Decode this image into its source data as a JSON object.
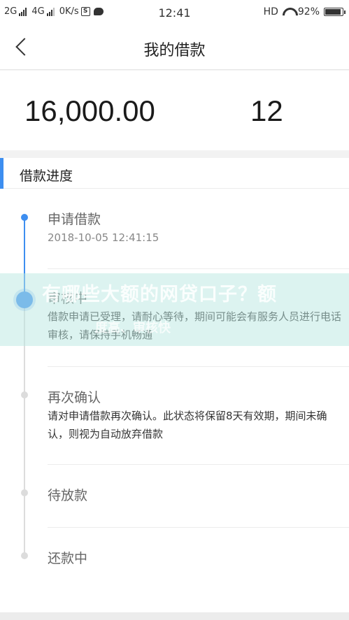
{
  "status_bar": {
    "net1": "2G",
    "net2": "4G",
    "speed": "0K/s",
    "time": "12:41",
    "hd": "HD",
    "battery": "92%",
    "battery_level": 0.92,
    "icons": [
      "signal-icon",
      "sim-icon",
      "chat-icon",
      "wifi-icon",
      "battery-icon"
    ]
  },
  "nav": {
    "title": "我的借款",
    "back_icon": "chevron-left-icon"
  },
  "summary": {
    "amount": "16,000.00",
    "term": "12"
  },
  "progress": {
    "section_title": "借款进度",
    "accent_color": "#3d8ef0",
    "steps": [
      {
        "title": "申请借款",
        "sub": "2018-10-05 12:41:15"
      },
      {
        "title": "审核中",
        "desc": "借款申请已受理，请耐心等待，期间可能会有服务人员进行电话审核，请保持手机畅通"
      },
      {
        "title": "再次确认",
        "desc": "请对申请借款再次确认。此状态将保留8天有效期，期间未确认，则视为自动放弃借款"
      },
      {
        "title": "待放款"
      },
      {
        "title": "还款中"
      }
    ]
  },
  "overlay": {
    "headline": "有哪些大额的网贷口子？额",
    "sub": "度高、审核快"
  }
}
